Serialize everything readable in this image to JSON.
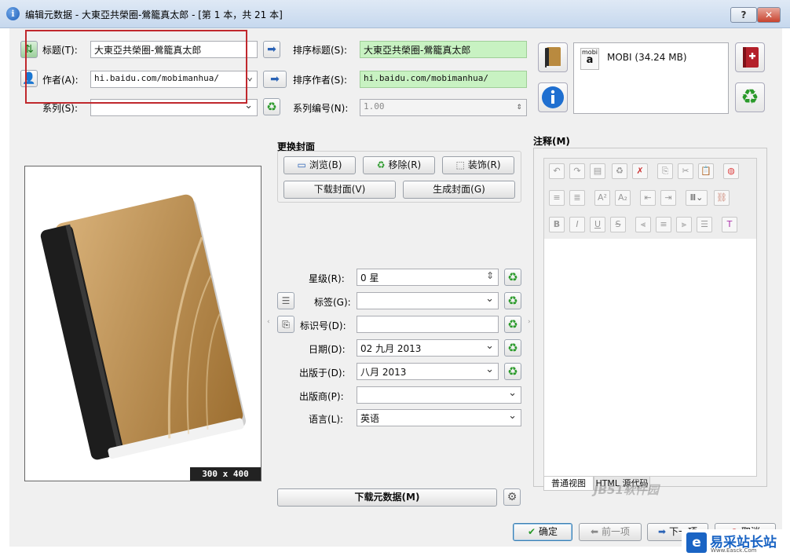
{
  "window": {
    "title": "编辑元数据 - 大東亞共榮圈-鶯籠真太郎 - [第 1 本，共 21 本]",
    "help_label": "?",
    "close_label": "✕"
  },
  "basic": {
    "title_label": "标题(T):",
    "title_value": "大東亞共榮圈-鶯籠真太郎",
    "author_label": "作者(A):",
    "author_value": "hi.baidu.com/mobimanhua/",
    "series_label": "系列(S):",
    "series_value": "",
    "sort_title_label": "排序标题(S):",
    "sort_title_value": "大東亞共榮圈-鶯籠真太郎",
    "sort_author_label": "排序作者(S):",
    "sort_author_value": "hi.baidu.com/mobimanhua/",
    "series_index_label": "系列编号(N):",
    "series_index_value": "1.00"
  },
  "format": {
    "badge": "mobi",
    "name": "MOBI (34.24 MB)"
  },
  "cover": {
    "group_label": "更换封面",
    "browse": "浏览(B)",
    "remove": "移除(R)",
    "trim": "装饰(R)",
    "download": "下载封面(V)",
    "generate": "生成封面(G)",
    "size": "300 x 400"
  },
  "fields": {
    "rating_label": "星级(R):",
    "rating_value": "0 星",
    "tags_label": "标签(G):",
    "tags_value": "",
    "ids_label": "标识号(D):",
    "ids_value": "",
    "date_label": "日期(D):",
    "date_value": "02 九月 2013",
    "pubdate_label": "出版于(D):",
    "pubdate_value": "八月 2013",
    "publisher_label": "出版商(P):",
    "publisher_value": "",
    "language_label": "语言(L):",
    "language_value": "英语"
  },
  "download_meta": "下载元数据(M)",
  "comments": {
    "label": "注释(M)",
    "tab_normal": "普通视图",
    "tab_html": "HTML 源代码"
  },
  "footer": {
    "ok": "确定",
    "prev": "前一项",
    "next": "下一项",
    "cancel": "取消"
  },
  "watermark": {
    "brand": "易采站长站",
    "sub": "Www.Easck.Com",
    "overlay": "JB51软件园"
  },
  "colors": {
    "green_field": "#c8f2c2",
    "highlight_box": "#c0282d",
    "title_bar": "#c6d8ee"
  }
}
